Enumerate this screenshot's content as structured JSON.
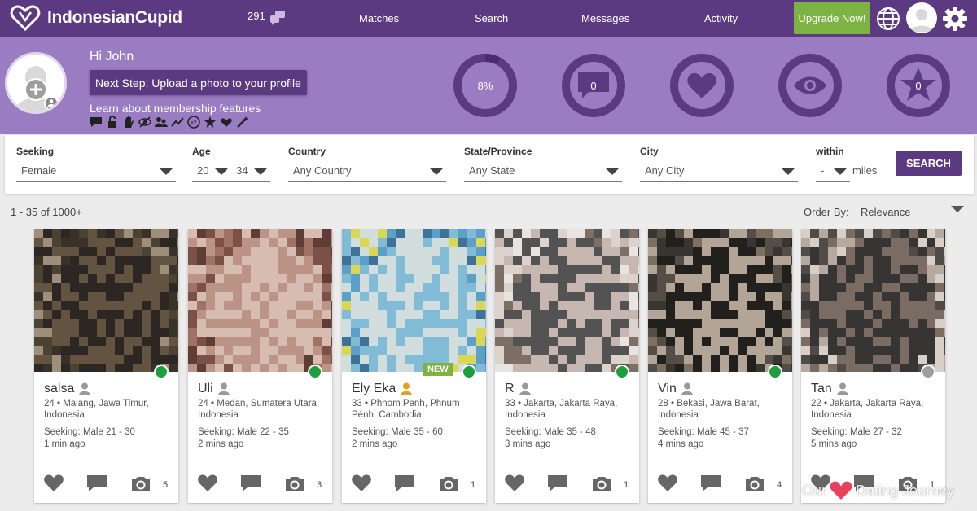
{
  "brand": {
    "name": "IndonesianCupid",
    "accent": "#5b3a82",
    "band": "#9a7cc2",
    "upgrade_color": "#7cb342"
  },
  "nav": {
    "notifications": "291",
    "links": [
      "Matches",
      "Search",
      "Messages",
      "Activity"
    ],
    "upgrade_label": "Upgrade Now!"
  },
  "profile": {
    "greeting": "Hi John",
    "next_step": "Next Step: Upload a photo to your profile",
    "learn_link": "Learn about membership features",
    "feature_icons": [
      "message-icon",
      "unlock-icon",
      "hand-icon",
      "hidden-icon",
      "users-icon",
      "chart-icon",
      "x2-icon",
      "star-icon",
      "hearts-icon",
      "magic-icon"
    ],
    "stats": [
      {
        "icon": "progress-ring",
        "value": "8%",
        "progress": 0.08
      },
      {
        "icon": "message-icon",
        "value": "0"
      },
      {
        "icon": "heart-icon",
        "value": ""
      },
      {
        "icon": "eye-icon",
        "value": ""
      },
      {
        "icon": "star-icon",
        "value": "0"
      }
    ]
  },
  "search": {
    "seeking_label": "Seeking",
    "seeking_value": "Female",
    "age_label": "Age",
    "age_min": "20",
    "age_max": "34",
    "country_label": "Country",
    "country_value": "Any Country",
    "state_label": "State/Province",
    "state_value": "Any State",
    "city_label": "City",
    "city_value": "Any City",
    "within_label": "within",
    "within_value": "-",
    "miles_label": "miles",
    "button_label": "SEARCH"
  },
  "results": {
    "count_text": "1 - 35 of 1000+",
    "order_label": "Order By:",
    "order_value": "Relevance"
  },
  "cards": [
    {
      "name": "salsa",
      "age_loc": "24 • Malang, Jawa Timur, Indonesia",
      "seeking": "Seeking: Male 21 - 30",
      "time": "1 min ago",
      "photos": "5",
      "online": true,
      "new": false,
      "user_icon_color": "#999999"
    },
    {
      "name": "Uli",
      "age_loc": "24 • Medan, Sumatera Utara, Indonesia",
      "seeking": "Seeking: Male 22 - 35",
      "time": "2 mins ago",
      "photos": "3",
      "online": true,
      "new": false,
      "user_icon_color": "#999999"
    },
    {
      "name": "Ely Eka",
      "age_loc": "33 • Phnom Penh, Phnum Pénh, Cambodia",
      "seeking": "Seeking: Male 35 - 60",
      "time": "2 mins ago",
      "photos": "1",
      "online": true,
      "new": true,
      "new_label": "NEW",
      "user_icon_color": "#e0a020"
    },
    {
      "name": "R",
      "age_loc": "33 • Jakarta, Jakarta Raya, Indonesia",
      "seeking": "Seeking: Male 35 - 48",
      "time": "3 mins ago",
      "photos": "1",
      "online": true,
      "new": false,
      "user_icon_color": "#999999"
    },
    {
      "name": "Vin",
      "age_loc": "28 • Bekasi, Jawa Barat, Indonesia",
      "seeking": "Seeking: Male 45 - 37",
      "time": "4 mins ago",
      "photos": "4",
      "online": true,
      "new": false,
      "user_icon_color": "#999999"
    },
    {
      "name": "Tan",
      "age_loc": "22 • Jakarta, Jakarta Raya, Indonesia",
      "seeking": "Seeking: Male 27 - 32",
      "time": "5 mins ago",
      "photos": "1",
      "online": false,
      "new": false,
      "user_icon_color": "#999999"
    }
  ],
  "watermark": {
    "left": "Our",
    "right": "Dating Journey"
  }
}
